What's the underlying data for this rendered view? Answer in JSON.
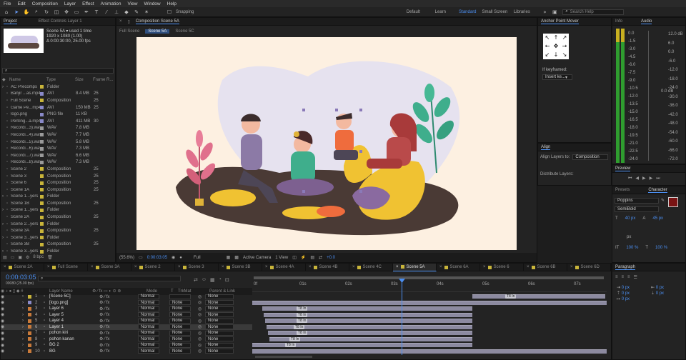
{
  "menu": [
    "File",
    "Edit",
    "Composition",
    "Layer",
    "Effect",
    "Animation",
    "View",
    "Window",
    "Help"
  ],
  "toolbar": {
    "snapping": "Snapping",
    "workspaces": [
      "Default",
      "Learn",
      "Standard",
      "Small Screen",
      "Libraries"
    ],
    "active_ws": "Standard",
    "search_placeholder": "Search Help"
  },
  "project": {
    "tabs": [
      "Project",
      "Effect Controls Layer 1"
    ],
    "info_name": "Scene 5A",
    "info_used": "used 1 time",
    "info_size": "1920 x 1080 (1.00)",
    "info_dur": "Δ 0:00:30:00, 25.00 fps",
    "columns": [
      "Name",
      "Type",
      "Size",
      "Frame R..."
    ],
    "rows": [
      {
        "n": "AC Precomps",
        "c": "#c9b53a",
        "t": "Folder",
        "s": "",
        "f": ""
      },
      {
        "n": "Banjir ...as.mp4",
        "c": "#8a8ac9",
        "t": "AVI",
        "s": "8.4 MB",
        "f": "25"
      },
      {
        "n": "Full Scene",
        "c": "#c9b53a",
        "t": "Composition",
        "s": "",
        "f": "25"
      },
      {
        "n": "Game Pe...mp4",
        "c": "#8a8ac9",
        "t": "AVI",
        "s": "150 MB",
        "f": "25"
      },
      {
        "n": "logo.png",
        "c": "#8a8ac9",
        "t": "PNG file",
        "s": "11 KB",
        "f": ""
      },
      {
        "n": "Penting...a.mp4",
        "c": "#8a8ac9",
        "t": "AVI",
        "s": "411 MB",
        "f": "30"
      },
      {
        "n": "Recordi...3).wav",
        "c": "#9a9a9a",
        "t": "WAV",
        "s": "7.8 MB",
        "f": ""
      },
      {
        "n": "Recordi...4).wav",
        "c": "#9a9a9a",
        "t": "WAV",
        "s": "7.7 MB",
        "f": ""
      },
      {
        "n": "Recordi...5).wav",
        "c": "#9a9a9a",
        "t": "WAV",
        "s": "5.8 MB",
        "f": ""
      },
      {
        "n": "Recordi...6).wav",
        "c": "#9a9a9a",
        "t": "WAV",
        "s": "7.3 MB",
        "f": ""
      },
      {
        "n": "Recordi...7).wav",
        "c": "#9a9a9a",
        "t": "WAV",
        "s": "6.6 MB",
        "f": ""
      },
      {
        "n": "Recordi...8).wav",
        "c": "#9a9a9a",
        "t": "WAV",
        "s": "7.3 MB",
        "f": ""
      },
      {
        "n": "Scene 2",
        "c": "#c9b53a",
        "t": "Composition",
        "s": "",
        "f": "25"
      },
      {
        "n": "Scene 3",
        "c": "#c9b53a",
        "t": "Composition",
        "s": "",
        "f": "25"
      },
      {
        "n": "Scene 6",
        "c": "#c9b53a",
        "t": "Composition",
        "s": "",
        "f": "25"
      },
      {
        "n": "Scene 1A",
        "c": "#c9b53a",
        "t": "Composition",
        "s": "",
        "f": "25"
      },
      {
        "n": "Scene 1...yers",
        "c": "#c9b53a",
        "t": "Folder",
        "s": "",
        "f": ""
      },
      {
        "n": "Scene 1B",
        "c": "#c9b53a",
        "t": "Composition",
        "s": "",
        "f": "25"
      },
      {
        "n": "Scene 1...yers",
        "c": "#c9b53a",
        "t": "Folder",
        "s": "",
        "f": ""
      },
      {
        "n": "Scene 2A",
        "c": "#c9b53a",
        "t": "Composition",
        "s": "",
        "f": "25"
      },
      {
        "n": "Scene 2...yers",
        "c": "#c9b53a",
        "t": "Folder",
        "s": "",
        "f": ""
      },
      {
        "n": "Scene 3A",
        "c": "#c9b53a",
        "t": "Composition",
        "s": "",
        "f": "25"
      },
      {
        "n": "Scene 3...yers",
        "c": "#c9b53a",
        "t": "Folder",
        "s": "",
        "f": ""
      },
      {
        "n": "Scene 3B",
        "c": "#c9b53a",
        "t": "Composition",
        "s": "",
        "f": "25"
      },
      {
        "n": "Scene 3...yers",
        "c": "#c9b53a",
        "t": "Folder",
        "s": "",
        "f": ""
      }
    ],
    "bpc": "8 bpc"
  },
  "comp": {
    "tab": "Composition Scene 5A",
    "subtabs": [
      "Full Scene",
      "Scene 5A",
      "Scene 5C"
    ],
    "zoom": "(55.6%)",
    "time": "0:00:03:05",
    "res": "Full",
    "camera": "Active Camera",
    "view": "1 View",
    "exposure": "+0.0"
  },
  "right": {
    "anchor": "Anchor Point Mover",
    "if_key": "If keyframed:",
    "insert": "Insert ke...",
    "align": "Align",
    "align_to_label": "Align Layers to:",
    "align_to": "Composition",
    "distribute": "Distribute Layers:",
    "preview": "Preview",
    "info": "Info",
    "audio": "Audio",
    "db_left": [
      "0.0",
      "-1.5",
      "-3.0",
      "-4.5",
      "-6.0",
      "-7.5",
      "-9.0",
      "-10.5",
      "-12.0",
      "-13.5",
      "-15.0",
      "-16.5",
      "-18.0",
      "-19.5",
      "-21.0",
      "-22.5",
      "-24.0"
    ],
    "db_right": [
      "12.0 dB",
      "6.0",
      "0.0",
      "-6.0",
      "-12.0",
      "-18.0",
      "-24.0",
      "-30.0",
      "-36.0",
      "-42.0",
      "-48.0",
      "-54.0",
      "-60.0",
      "-66.0",
      "-72.0"
    ],
    "db_mid": "0.0 dB",
    "presets": "Presets",
    "character": "Character",
    "font": "Poppins",
    "style": "SemiBold",
    "size": "40 px",
    "leading": "45 px",
    "units": "px",
    "scale": "100 %",
    "paragraph": "Paragraph",
    "pvals": [
      "0 px",
      "0 px",
      "0 px",
      "0 px",
      "0 px"
    ]
  },
  "timeline": {
    "tabs": [
      "Scene 2A",
      "Full Scene",
      "Scene 3A",
      "Scene 2",
      "Scene 3",
      "Scene 3B",
      "Scene 4A",
      "Scene 4B",
      "Scene 4C",
      "Scene 5A",
      "Scene 6A",
      "Scene 6",
      "Scene 6B",
      "Scene 6D"
    ],
    "active": "Scene 5A",
    "time": "0:00:03:05",
    "frames": "00080 (25.00 fps)",
    "cols": {
      "name": "Layer Name",
      "mode": "Mode",
      "t": "T",
      "trk": "TrkMat",
      "parent": "Parent & Link"
    },
    "ticks": [
      "0f",
      "01s",
      "02s",
      "03s",
      "04s",
      "05s",
      "06s",
      "07s"
    ],
    "layers": [
      {
        "i": "1",
        "n": "[Scene 5C]",
        "c": "#c9b53a",
        "m": "Normal",
        "tr": "",
        "p": "None"
      },
      {
        "i": "2",
        "n": "[logo.png]",
        "c": "#8a8ac9",
        "m": "Normal",
        "tr": "None",
        "p": "None"
      },
      {
        "i": "3",
        "n": "Layer 6",
        "c": "#c97a3a",
        "m": "Normal",
        "tr": "None",
        "p": "None"
      },
      {
        "i": "4",
        "n": "Layer 5",
        "c": "#c97a3a",
        "m": "Normal",
        "tr": "None",
        "p": "None"
      },
      {
        "i": "5",
        "n": "Layer 4",
        "c": "#c97a3a",
        "m": "Normal",
        "tr": "None",
        "p": "None"
      },
      {
        "i": "6",
        "n": "Layer 1",
        "c": "#c97a3a",
        "m": "Normal",
        "tr": "None",
        "p": "None"
      },
      {
        "i": "7",
        "n": "pohon kiri",
        "c": "#c97a3a",
        "m": "Normal",
        "tr": "None",
        "p": "None"
      },
      {
        "i": "8",
        "n": "pohon kanan",
        "c": "#c97a3a",
        "m": "Normal",
        "tr": "None",
        "p": "None"
      },
      {
        "i": "9",
        "n": "BG 2",
        "c": "#c97a3a",
        "m": "Normal",
        "tr": "None",
        "p": "None"
      },
      {
        "i": "10",
        "n": "BG",
        "c": "#c97a3a",
        "m": "Normal",
        "tr": "None",
        "p": "None"
      }
    ],
    "kflabel": "T8 In"
  },
  "colors": {
    "accent": "#4b8ef0",
    "playhead": "#4b8ef0",
    "canvas": "#fdf0e1"
  }
}
